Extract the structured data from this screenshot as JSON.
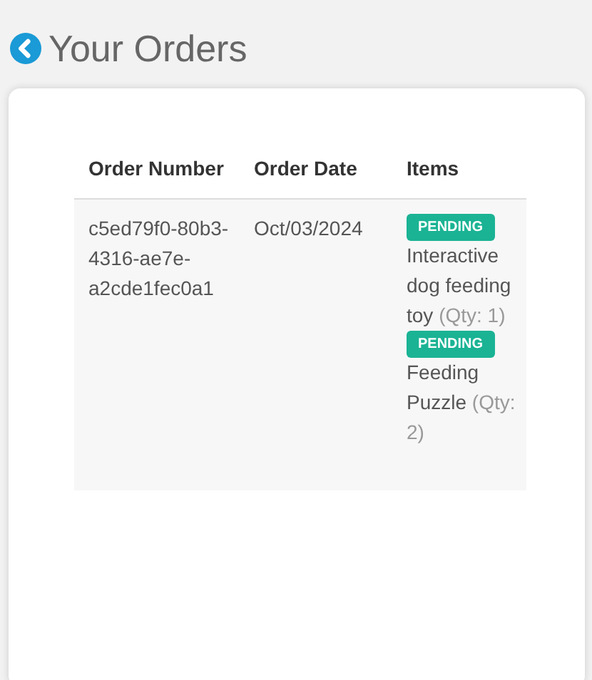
{
  "header": {
    "title": "Your Orders"
  },
  "table": {
    "columns": [
      "Order Number",
      "Order Date",
      "Items"
    ],
    "rows": [
      {
        "order_number": "c5ed79f0-80b3-4316-ae7e-a2cde1fec0a1",
        "order_date": "Oct/03/2024",
        "items": [
          {
            "status": "PENDING",
            "name": "Interactive dog feeding toy",
            "qty": "(Qty: 1)"
          },
          {
            "status": "PENDING",
            "name": "Feeding Puzzle",
            "qty": "(Qty: 2)"
          }
        ]
      }
    ]
  }
}
